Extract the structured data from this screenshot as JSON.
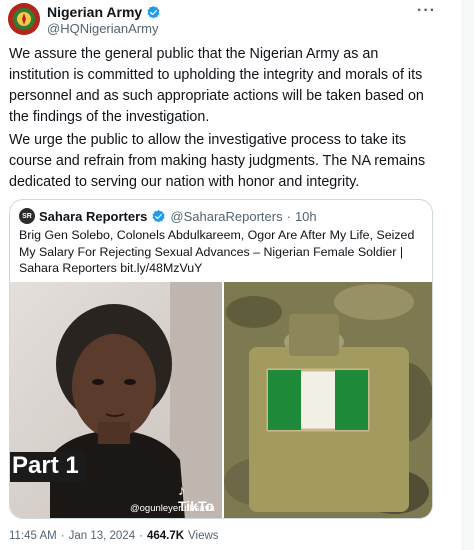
{
  "author": {
    "display_name": "Nigerian Army",
    "handle": "@HQNigerianArmy",
    "verified": true
  },
  "more_icon": "more-horizontal-icon",
  "body": {
    "paragraph1": "We assure the general public that the Nigerian Army as an institution is committed to upholding the integrity and morals of its personnel and as such appropriate actions will be  taken based on the findings of the investigation.",
    "paragraph2": "We urge the public to allow the investigative process to take its course and refrain from making hasty judgments. The NA remains dedicated to serving our nation with honor and integrity."
  },
  "quote": {
    "logo_text": "SR",
    "display_name": "Sahara Reporters",
    "verified": true,
    "handle": "@SaharaReporters",
    "separator": "·",
    "time": "10h",
    "text": "Brig Gen Solebo, Colonels Abdulkareem, Ogor Are After My Life, Seized My Salary For Rejecting Sexual Advances – Nigerian Female Soldier | Sahara Reporters bit.ly/48MzVuY",
    "media": {
      "left_caption": "Part 1",
      "tiktok_label": "TikTo",
      "tiktok_user": "@ogunleyeruthsava"
    }
  },
  "meta": {
    "time": "11:45 AM",
    "separator1": "·",
    "date": "Jan 13, 2024",
    "separator2": "·",
    "views_count": "464.7K",
    "views_label": "Views"
  },
  "colors": {
    "verified_blue": "#1d9bf0",
    "text_primary": "#0f1419",
    "text_secondary": "#536471",
    "border": "#cfd9de",
    "flag_green": "#1e8a3a"
  }
}
